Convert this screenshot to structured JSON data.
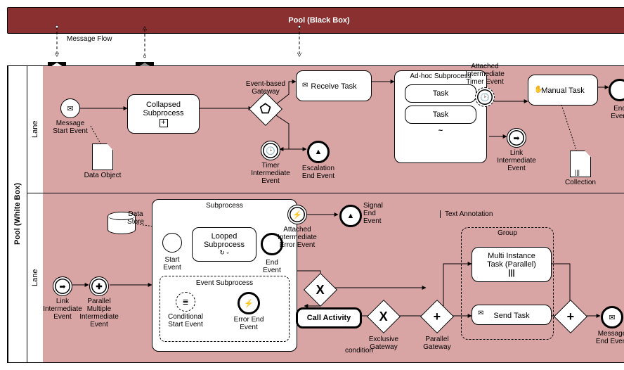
{
  "black_pool_title": "Pool (Black Box)",
  "white_pool_label": "Pool (White Box)",
  "lane1_label": "Lane",
  "lane2_label": "Lane",
  "msg_flow_label": "Message Flow",
  "lane1": {
    "message_start_event": "Message\nStart Event",
    "data_object": "Data Object",
    "collapsed_subprocess": "Collapsed\nSubprocess",
    "event_based_gateway": "Event-based\nGateway",
    "receive_task": "Receive Task",
    "timer_intermediate_event": "Timer\nIntermediate\nEvent",
    "escalation_end_event": "Escalation\nEnd Event",
    "adhoc_subprocess_title": "Ad-hoc Subprocess",
    "adhoc_task1": "Task",
    "adhoc_task2": "Task",
    "attached_timer_event": "Attached\nIntermediate\nTimer Event",
    "link_intermediate_event": "Link\nIntermediate\nEvent",
    "manual_task": "Manual Task",
    "end_event": "End\nEvent",
    "collection": "Collection"
  },
  "lane2": {
    "link_intermediate_event": "Link\nIntermediate\nEvent",
    "parallel_multiple_intermediate_event": "Parallel\nMultiple\nIntermediate\nEvent",
    "data_store": "Data\nStore",
    "subprocess_title": "Subprocess",
    "start_event": "Start\nEvent",
    "looped_subprocess": "Looped\nSubprocess",
    "subprocess_end_event": "End\nEvent",
    "event_subprocess_title": "Event Subprocess",
    "conditional_start_event": "Conditional\nStart Event",
    "error_end_event": "Error End\nEvent",
    "attached_error_event": "Attached\nIntermediate\nError Event",
    "signal_end_event": "Signal\nEnd\nEvent",
    "condition_label": "condition",
    "call_activity": "Call Activity",
    "exclusive_gateway": "Exclusive\nGateway",
    "parallel_gateway": "Parallel\nGateway",
    "text_annotation": "Text Annotation",
    "group_title": "Group",
    "multi_instance_task": "Multi Instance\nTask (Parallel)",
    "send_task": "Send Task",
    "message_end_event": "Message\nEnd Event"
  }
}
